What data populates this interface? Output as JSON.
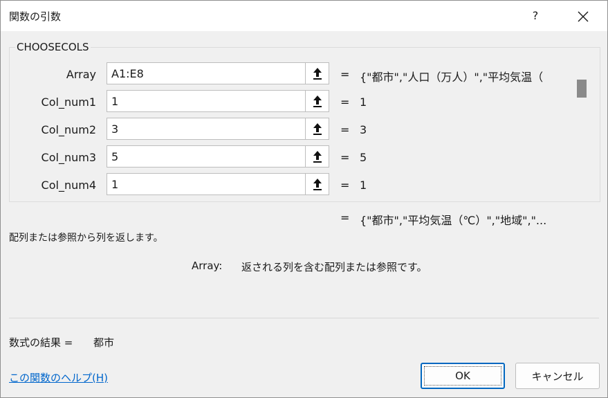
{
  "window": {
    "title": "関数の引数",
    "help_glyph": "?"
  },
  "function_name": "CHOOSECOLS",
  "arguments": [
    {
      "label": "Array",
      "value": "A1:E8",
      "result": "{\"都市\",\"人口（万人）\",\"平均気温（"
    },
    {
      "label": "Col_num1",
      "value": "1",
      "result": "1"
    },
    {
      "label": "Col_num2",
      "value": "3",
      "result": "3"
    },
    {
      "label": "Col_num3",
      "value": "5",
      "result": "5"
    },
    {
      "label": "Col_num4",
      "value": "1",
      "result": "1"
    }
  ],
  "equals_sign": "=",
  "overall_result": "{\"都市\",\"平均気温（℃）\",\"地域\",\"...",
  "description": "配列または参照から列を返します。",
  "arg_description": {
    "label": "Array:",
    "text": "返される列を含む配列または参照です。"
  },
  "formula_result": {
    "label": "数式の結果 =",
    "value": "都市"
  },
  "help_link": "この関数のヘルプ(H)",
  "buttons": {
    "ok": "OK",
    "cancel": "キャンセル"
  },
  "icons": {
    "close": "close-icon",
    "ref": "collapse-dialog-arrow-icon"
  },
  "colors": {
    "link": "#0066cc",
    "ok_border": "#0067c0"
  }
}
